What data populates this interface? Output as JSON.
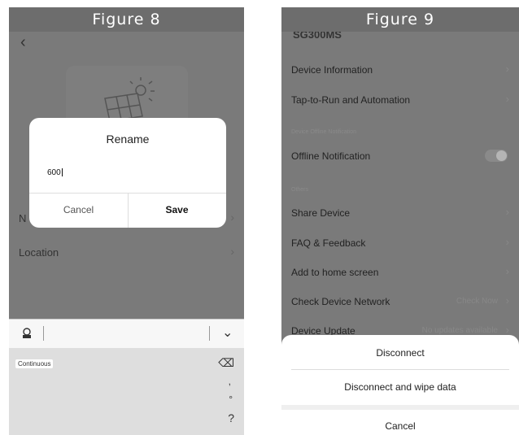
{
  "figure8": {
    "title": "Figure 8",
    "rows": [
      {
        "label": "N",
        "chevron": "›"
      },
      {
        "label": "Location",
        "chevron": "›"
      }
    ],
    "dialog": {
      "title": "Rename",
      "value": "600",
      "cancel": "Cancel",
      "save": "Save"
    },
    "keyboard": {
      "suggestion": "Continuous",
      "keys": [
        "⌫",
        ",",
        "°",
        "?"
      ],
      "collapse": "⌄"
    }
  },
  "figure9": {
    "title": "Figure 9",
    "device_name": "SG300MS",
    "items": [
      {
        "label": "Device Information",
        "chevron": "›"
      },
      {
        "label": "Tap-to-Run and Automation",
        "chevron": "›"
      }
    ],
    "section_offline": "Device Offline Notification",
    "offline_label": "Offline Notification",
    "section_others": "Others",
    "others": [
      {
        "label": "Share Device",
        "chevron": "›"
      },
      {
        "label": "FAQ & Feedback",
        "chevron": "›"
      },
      {
        "label": "Add to home screen",
        "chevron": "›"
      },
      {
        "label": "Check Device Network",
        "value": "Check Now",
        "chevron": "›"
      },
      {
        "label": "Device Update",
        "value": "No updates available",
        "chevron": "›"
      }
    ],
    "sheet": {
      "disconnect": "Disconnect",
      "wipe": "Disconnect and wipe data",
      "cancel": "Cancel"
    }
  }
}
